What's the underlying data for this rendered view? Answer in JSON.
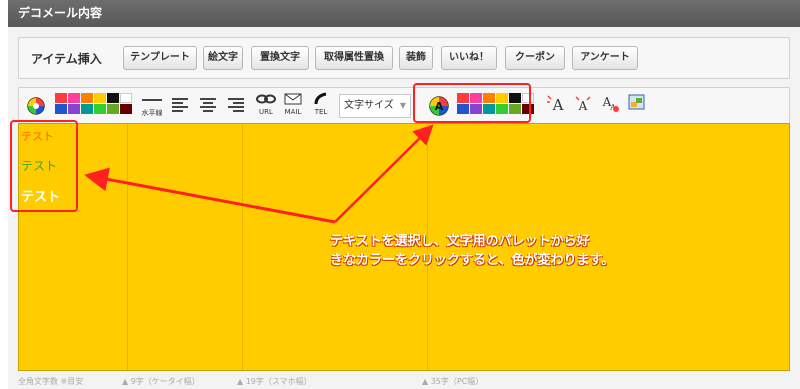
{
  "title": "デコメール内容",
  "item_insert": {
    "label": "アイテム挿入",
    "buttons": [
      "テンプレート",
      "絵文字",
      "置換文字",
      "取得属性置換",
      "装飾",
      "いいね！",
      "クーポン",
      "アンケート"
    ]
  },
  "toolbar": {
    "palette_colors_top": [
      "#ff3b3b",
      "#ff3f9f",
      "#ff7f00",
      "#ffcc00",
      "#111111",
      "#ffffff"
    ],
    "palette_colors_bottom": [
      "#2255cc",
      "#8844cc",
      "#009999",
      "#33cc33",
      "#66aa22",
      "#660000"
    ],
    "hr_label": "水平線",
    "url_label": "URL",
    "mail_label": "MAIL",
    "tel_label": "TEL",
    "font_size_select": "文字サイズ"
  },
  "editor": {
    "background": "#ffcc00",
    "samples": [
      {
        "text": "テスト",
        "color": "#ff6600"
      },
      {
        "text": "テスト",
        "color": "#33aa33"
      },
      {
        "text": "テスト",
        "color": "#ffffff"
      }
    ]
  },
  "footer": {
    "char_count_label": "全角文字数 ※目安",
    "guides": [
      "9字（ケータイ幅）",
      "19字（スマホ幅）",
      "35字（PC幅）"
    ]
  },
  "callout": {
    "line1": "テキストを選択し、文字用のパレットから好",
    "line2": "きなカラーをクリックすると、色が変わります。"
  }
}
